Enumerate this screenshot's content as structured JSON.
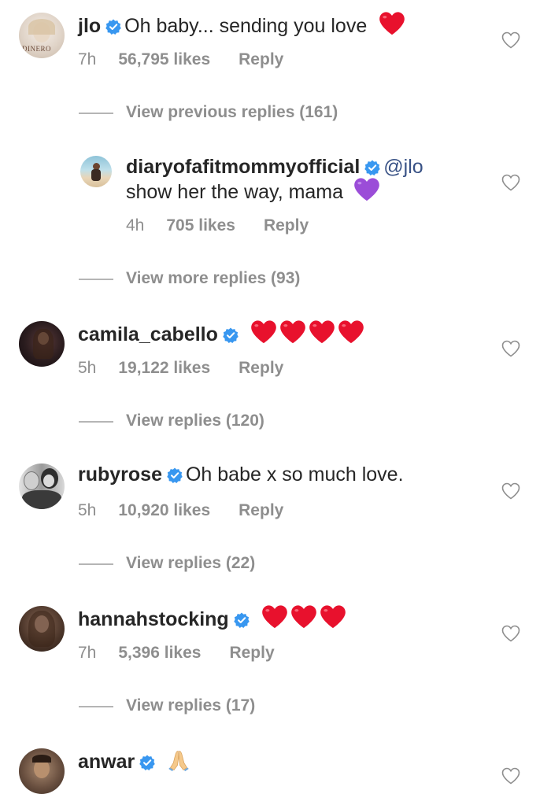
{
  "comments": [
    {
      "username": "jlo",
      "text": "Oh baby... sending you love",
      "emoji": "red-heart",
      "time": "7h",
      "likes": "56,795 likes",
      "reply": "Reply",
      "view_replies": "View previous replies (161)",
      "avatar_text": "DINERO"
    },
    {
      "username": "diaryofafitmommyofficial",
      "mention": "@jlo",
      "text": "show her the way, mama",
      "emoji": "purple-heart",
      "time": "4h",
      "likes": "705 likes",
      "reply": "Reply",
      "view_replies": "View more replies (93)"
    },
    {
      "username": "camila_cabello",
      "text": "",
      "emoji": "4 red hearts",
      "time": "5h",
      "likes": "19,122 likes",
      "reply": "Reply",
      "view_replies": "View replies (120)"
    },
    {
      "username": "rubyrose",
      "text": "Oh babe x so much love.",
      "time": "5h",
      "likes": "10,920 likes",
      "reply": "Reply",
      "view_replies": "View replies (22)"
    },
    {
      "username": "hannahstocking",
      "text": "",
      "emoji": "3 red hearts",
      "time": "7h",
      "likes": "5,396 likes",
      "reply": "Reply",
      "view_replies": "View replies (17)"
    },
    {
      "username": "anwar",
      "text": "",
      "emoji": "folded-hands"
    }
  ],
  "colors": {
    "verified": "#3897f0",
    "red_heart": "#e8112d",
    "purple_heart": "#9b4dd8",
    "muted_text": "#8e8e8e",
    "main_text": "#262626",
    "mention": "#385185"
  }
}
